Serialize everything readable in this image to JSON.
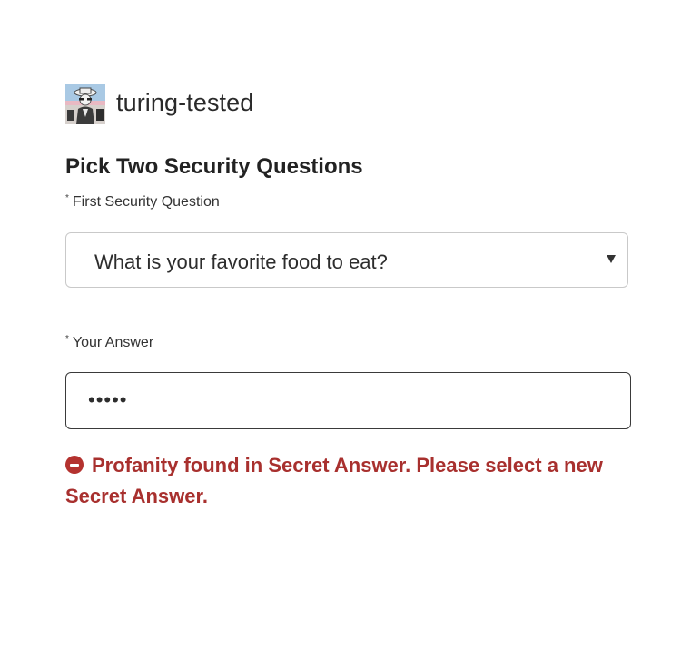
{
  "post": {
    "blog_name": "turing-tested"
  },
  "form": {
    "title": "Pick Two Security Questions",
    "required_marker": "*",
    "first_question": {
      "label": "First Security Question",
      "selected_value": "What is your favorite food to eat?"
    },
    "answer": {
      "label": "Your Answer",
      "masked_value": "•••••"
    },
    "error": {
      "text": "Profanity found in Secret Answer. Please select a new Secret Answer."
    }
  },
  "colors": {
    "error": "#a8302e",
    "input_border": "#3a3a3a",
    "select_border": "#c9c9c9"
  }
}
